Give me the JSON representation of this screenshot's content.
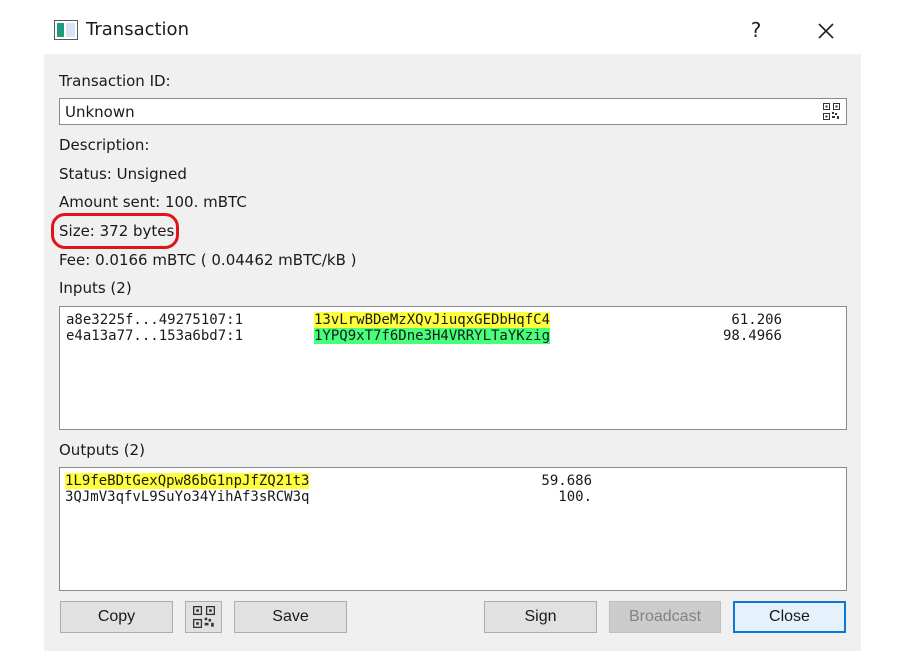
{
  "window": {
    "title": "Transaction",
    "help_label": "?"
  },
  "details": {
    "txid_label": "Transaction ID:",
    "txid_value": "Unknown",
    "description_label": "Description:",
    "status": "Status: Unsigned",
    "amount_sent": "Amount sent: 100. mBTC",
    "size": "Size: 372 bytes",
    "fee": "Fee: 0.0166 mBTC  ( 0.04462 mBTC/kB )"
  },
  "inputs": {
    "label": "Inputs (2)",
    "rows": [
      {
        "outpoint": "a8e3225f...49275107:1",
        "address": "13vLrwBDeMzXQvJiuqxGEDbHqfC4",
        "amount": "61.206"
      },
      {
        "outpoint": "e4a13a77...153a6bd7:1",
        "address": "1YPQ9xT7f6Dne3H4VRRYLTaYKzig",
        "amount": "98.4966"
      }
    ]
  },
  "outputs": {
    "label": "Outputs (2)",
    "rows": [
      {
        "address": "1L9feBDtGexQpw86bG1npJfZQ21t3",
        "amount": "59.686"
      },
      {
        "address": "3QJmV3qfvL9SuYo34YihAf3sRCW3q",
        "amount": "100."
      }
    ]
  },
  "buttons": {
    "copy": "Copy",
    "save": "Save",
    "sign": "Sign",
    "broadcast": "Broadcast",
    "close": "Close"
  },
  "icons": {
    "app": "transaction-window-icon",
    "qr": "qr-code-icon",
    "close": "close-icon"
  },
  "colors": {
    "input_address_1_highlight": "#ffff3c",
    "input_address_2_highlight": "#46ff7a",
    "output_address_1_highlight": "#ffff3c",
    "annotation_ring": "#e0141b",
    "default_button_border": "#0a78d7"
  }
}
